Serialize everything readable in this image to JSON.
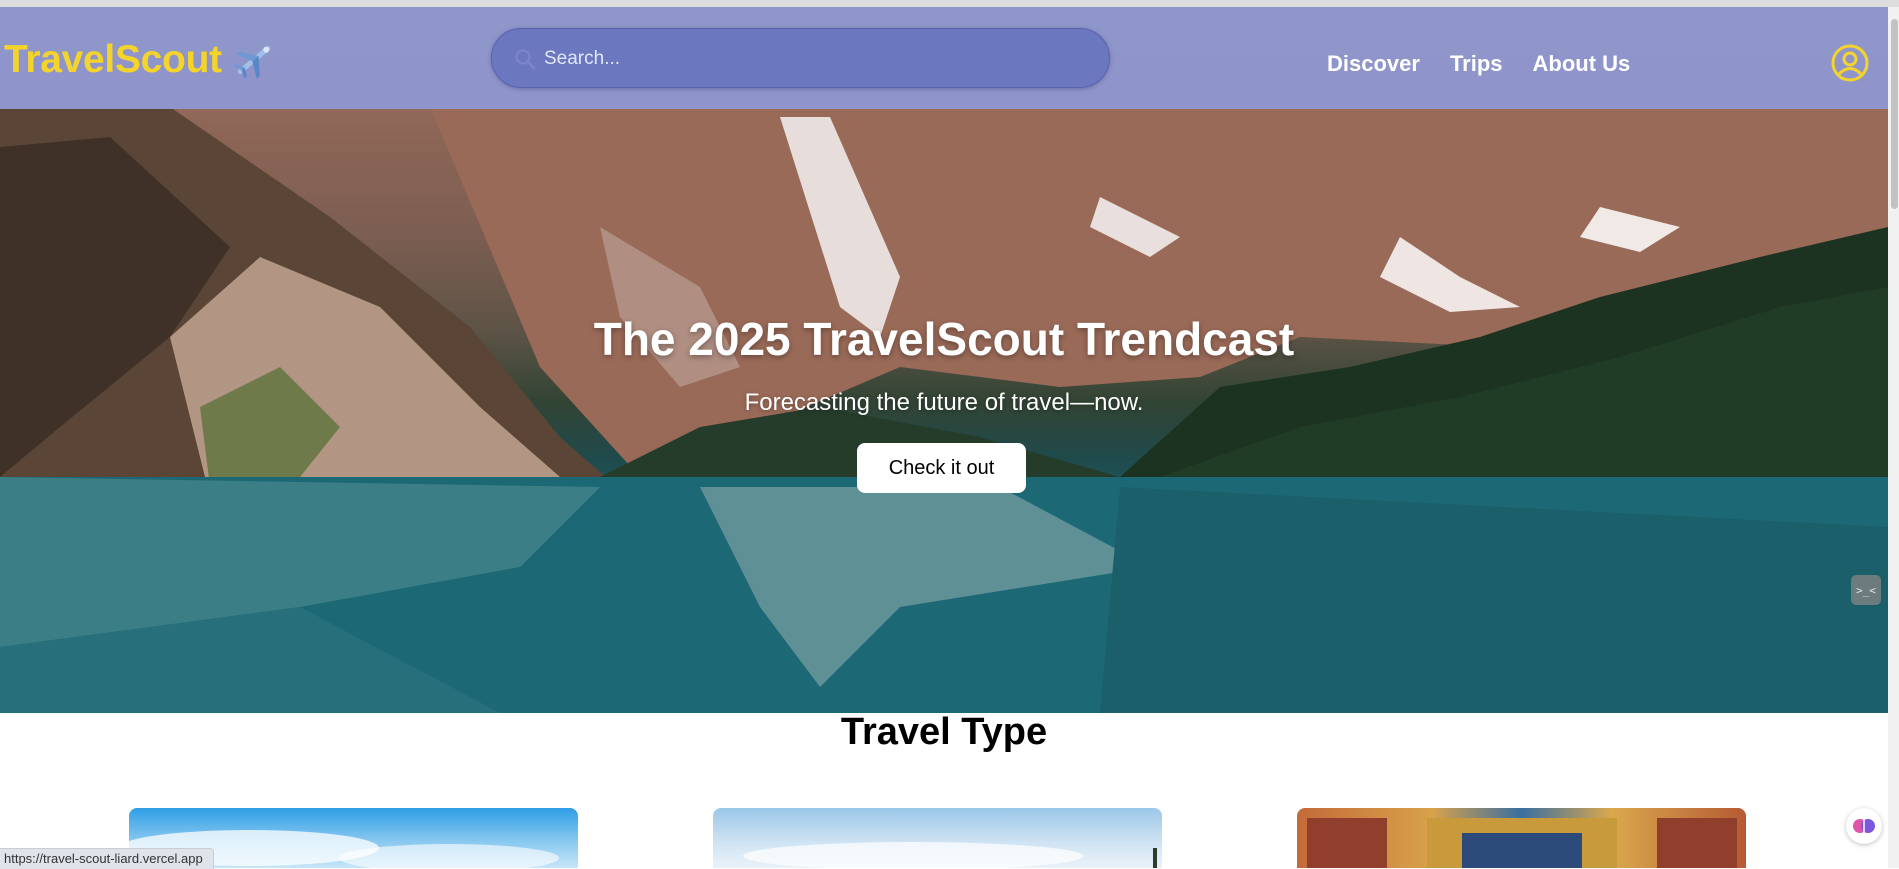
{
  "brand": {
    "name": "TravelScout",
    "logo_icon": "airplane-icon",
    "color": "#f4d42b"
  },
  "search": {
    "placeholder": "Search...",
    "value": ""
  },
  "nav": {
    "links": [
      {
        "label": "Discover"
      },
      {
        "label": "Trips"
      },
      {
        "label": "About Us"
      }
    ],
    "profile_icon": "user-circle-icon",
    "bar_color": "#8e97cd"
  },
  "hero": {
    "title": "The 2025 TravelScout Trendcast",
    "subtitle": "Forecasting the future of travel—now.",
    "cta_label": "Check it out"
  },
  "side_widget": {
    "label": ">_<"
  },
  "section": {
    "title": "Travel Type"
  },
  "status_bar": {
    "url": "https://travel-scout-liard.vercel.app"
  }
}
